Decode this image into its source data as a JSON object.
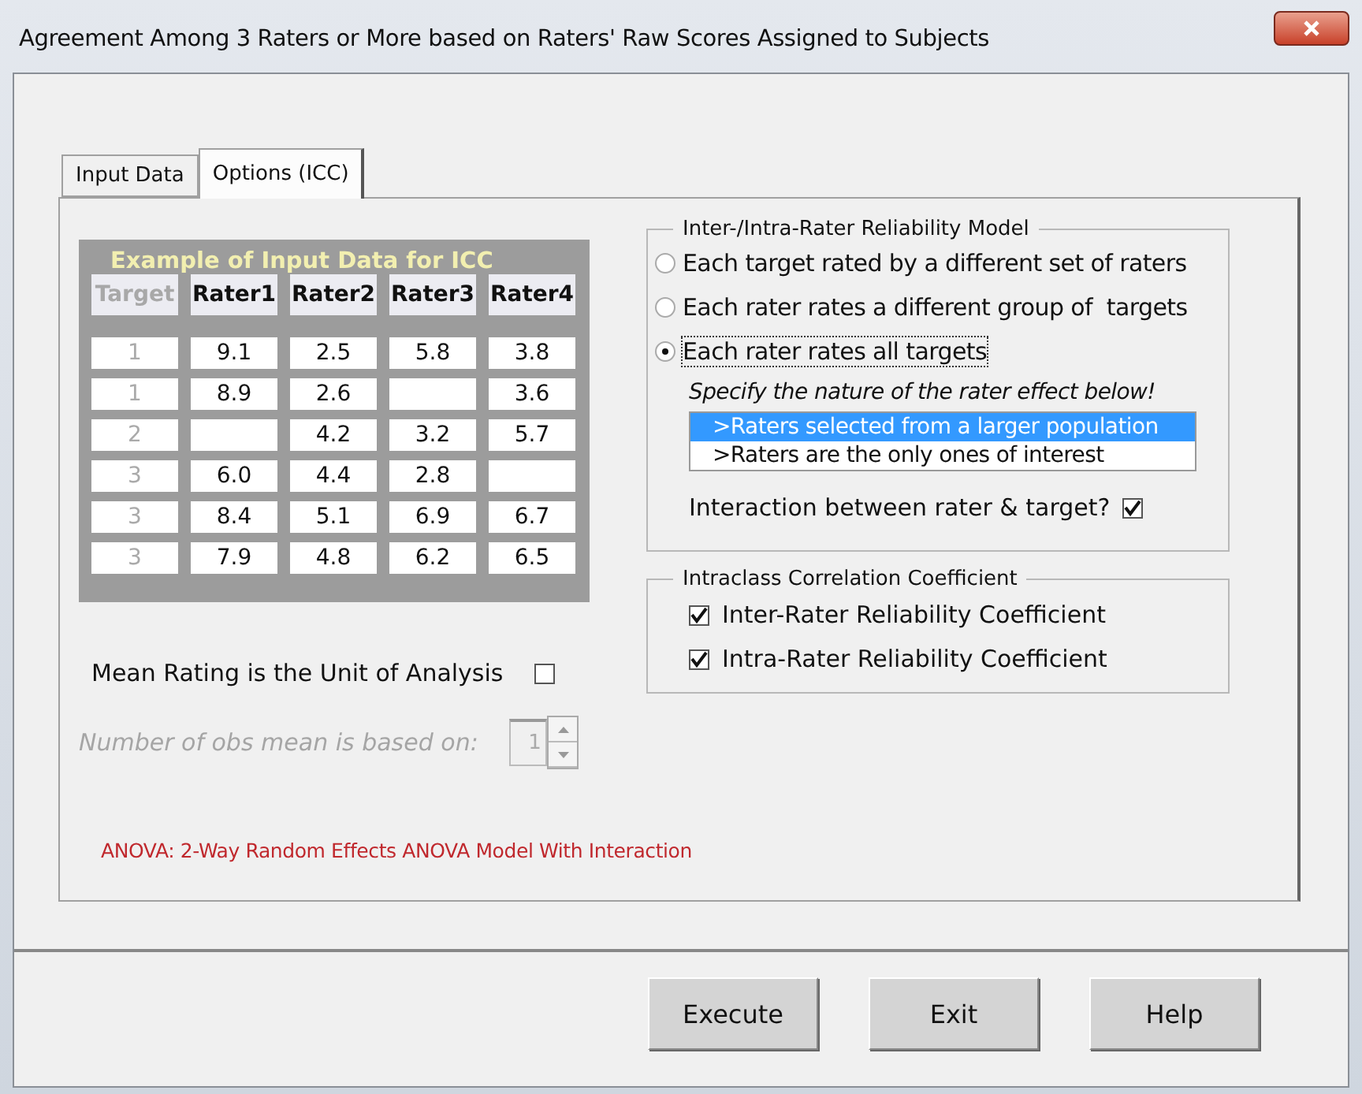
{
  "window": {
    "title": "Agreement Among 3 Raters or More based on Raters' Raw Scores Assigned to Subjects"
  },
  "tabs": [
    {
      "label": "Input Data",
      "selected": false
    },
    {
      "label": "Options (ICC)",
      "selected": true
    }
  ],
  "example": {
    "title": "Example of Input Data for ICC",
    "columns": [
      "Target",
      "Rater1",
      "Rater2",
      "Rater3",
      "Rater4"
    ],
    "rows": [
      [
        "1",
        "9.1",
        "2.5",
        "5.8",
        "3.8"
      ],
      [
        "1",
        "8.9",
        "2.6",
        null,
        "3.6"
      ],
      [
        "2",
        null,
        "4.2",
        "3.2",
        "5.7"
      ],
      [
        "3",
        "6.0",
        "4.4",
        "2.8",
        null
      ],
      [
        "3",
        "8.4",
        "5.1",
        "6.9",
        "6.7"
      ],
      [
        "3",
        "7.9",
        "4.8",
        "6.2",
        "6.5"
      ]
    ]
  },
  "mean_rating": {
    "label": "Mean Rating is the Unit of Analysis",
    "checked": false
  },
  "obs": {
    "label": "Number of obs mean is based on:",
    "value": "1",
    "disabled": true
  },
  "anova_note": "ANOVA: 2-Way Random Effects ANOVA Model With Interaction",
  "model": {
    "title": "Inter-/Intra-Rater Reliability Model",
    "options": [
      {
        "label": "Each target rated by a different set of raters",
        "selected": false
      },
      {
        "label": "Each rater rates a different group of  targets",
        "selected": false
      },
      {
        "label": "Each rater rates all targets",
        "selected": true
      }
    ],
    "hint": "Specify the nature of the rater effect below!",
    "effects": [
      {
        "label": ">Raters selected from a larger population",
        "selected": true
      },
      {
        "label": ">Raters are the only ones of interest",
        "selected": false
      }
    ],
    "interaction": {
      "label": "Interaction between rater & target?",
      "checked": true
    }
  },
  "icc": {
    "title": "Intraclass Correlation Coefficient",
    "options": [
      {
        "label": "Inter-Rater Reliability Coefficient",
        "checked": true
      },
      {
        "label": "Intra-Rater Reliability Coefficient",
        "checked": true
      }
    ]
  },
  "buttons": [
    "Execute",
    "Exit",
    "Help"
  ]
}
